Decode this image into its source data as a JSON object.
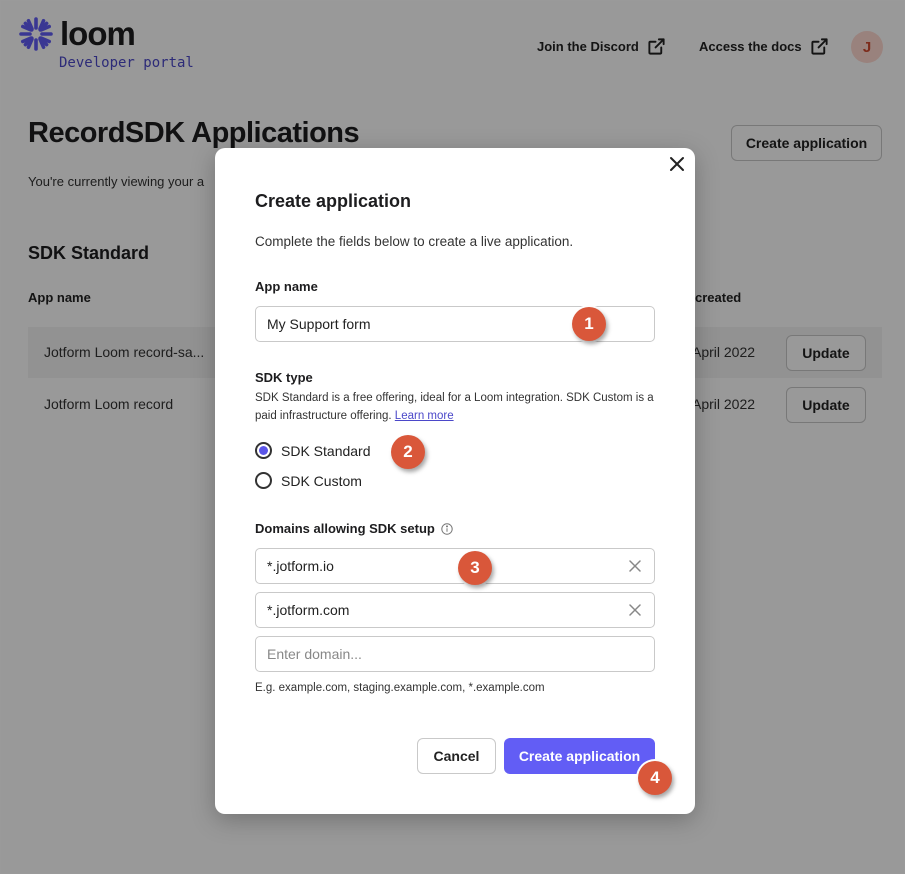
{
  "brand": {
    "name": "loom",
    "subtitle": "Developer portal",
    "logo_icon": "loom-asterisk-icon",
    "color": "#625df5"
  },
  "topnav": {
    "discord_label": "Join the Discord",
    "docs_label": "Access the docs",
    "external_icon": "external-link-icon",
    "avatar_initial": "J"
  },
  "page": {
    "title": "RecordSDK Applications",
    "create_button": "Create application",
    "description": "You're currently viewing your a",
    "section_title": "SDK Standard",
    "columns": {
      "name": "App name",
      "created": "created"
    },
    "rows": [
      {
        "name": "Jotform Loom record-sa...",
        "created": "April 2022",
        "action": "Update"
      },
      {
        "name": "Jotform Loom record",
        "created": "April 2022",
        "action": "Update"
      }
    ]
  },
  "modal": {
    "title": "Create application",
    "description": "Complete the fields below to create a live application.",
    "app_name_label": "App name",
    "app_name_value": "My Support form",
    "sdk_type_label": "SDK type",
    "sdk_type_desc": "SDK Standard is a free offering, ideal for a Loom integration. SDK Custom is a paid infrastructure offering.",
    "learn_more": "Learn more",
    "options": [
      {
        "label": "SDK Standard",
        "selected": true
      },
      {
        "label": "SDK Custom",
        "selected": false
      }
    ],
    "domains_label": "Domains allowing SDK setup",
    "domains": [
      "*.jotform.io",
      "*.jotform.com"
    ],
    "domain_placeholder": "Enter domain...",
    "domain_hint": "E.g. example.com, staging.example.com, *.example.com",
    "cancel_label": "Cancel",
    "submit_label": "Create application"
  },
  "step_badges": [
    "1",
    "2",
    "3",
    "4"
  ],
  "colors": {
    "primary": "#625df5",
    "badge": "#d9573a",
    "link": "#4b48c9"
  }
}
